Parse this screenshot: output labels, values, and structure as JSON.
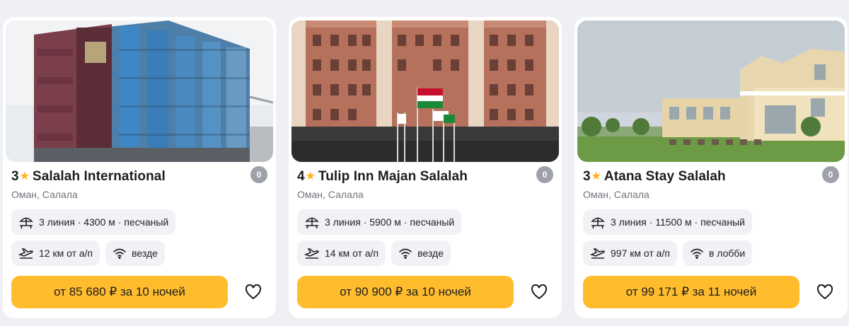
{
  "cards": [
    {
      "stars": "3",
      "name": "Salalah International",
      "rating": "0",
      "location": "Оман, Салала",
      "beach": "3 линия · 4300 м · песчаный",
      "airport": "12 км от а/п",
      "wifi": "везде",
      "price": "от 85 680 ₽ за 10 ночей",
      "photo": "modern-glass-tower"
    },
    {
      "stars": "4",
      "name": "Tulip Inn Majan Salalah",
      "rating": "0",
      "location": "Оман, Салала",
      "beach": "3 линия · 5900 м · песчаный",
      "airport": "14 км от а/п",
      "wifi": "везде",
      "price": "от 90 900 ₽ за 10 ночей",
      "photo": "brick-building-flags"
    },
    {
      "stars": "3",
      "name": "Atana Stay Salalah",
      "rating": "0",
      "location": "Оман, Салала",
      "beach": "3 линия · 11500 м · песчаный",
      "airport": "997 км от а/п",
      "wifi": "в лобби",
      "price": "от 99 171 ₽ за 11 ночей",
      "photo": "beige-villa-lawn"
    }
  ],
  "icons": {
    "star": "star-icon",
    "beach": "beach-umbrella-icon",
    "airport": "plane-icon",
    "wifi": "wifi-icon",
    "favorite": "heart-icon"
  },
  "colors": {
    "accent": "#ffbd2e",
    "star": "#ffb21e",
    "rating_badge": "#9ea2a8",
    "chip_bg": "#f1f2f5"
  }
}
